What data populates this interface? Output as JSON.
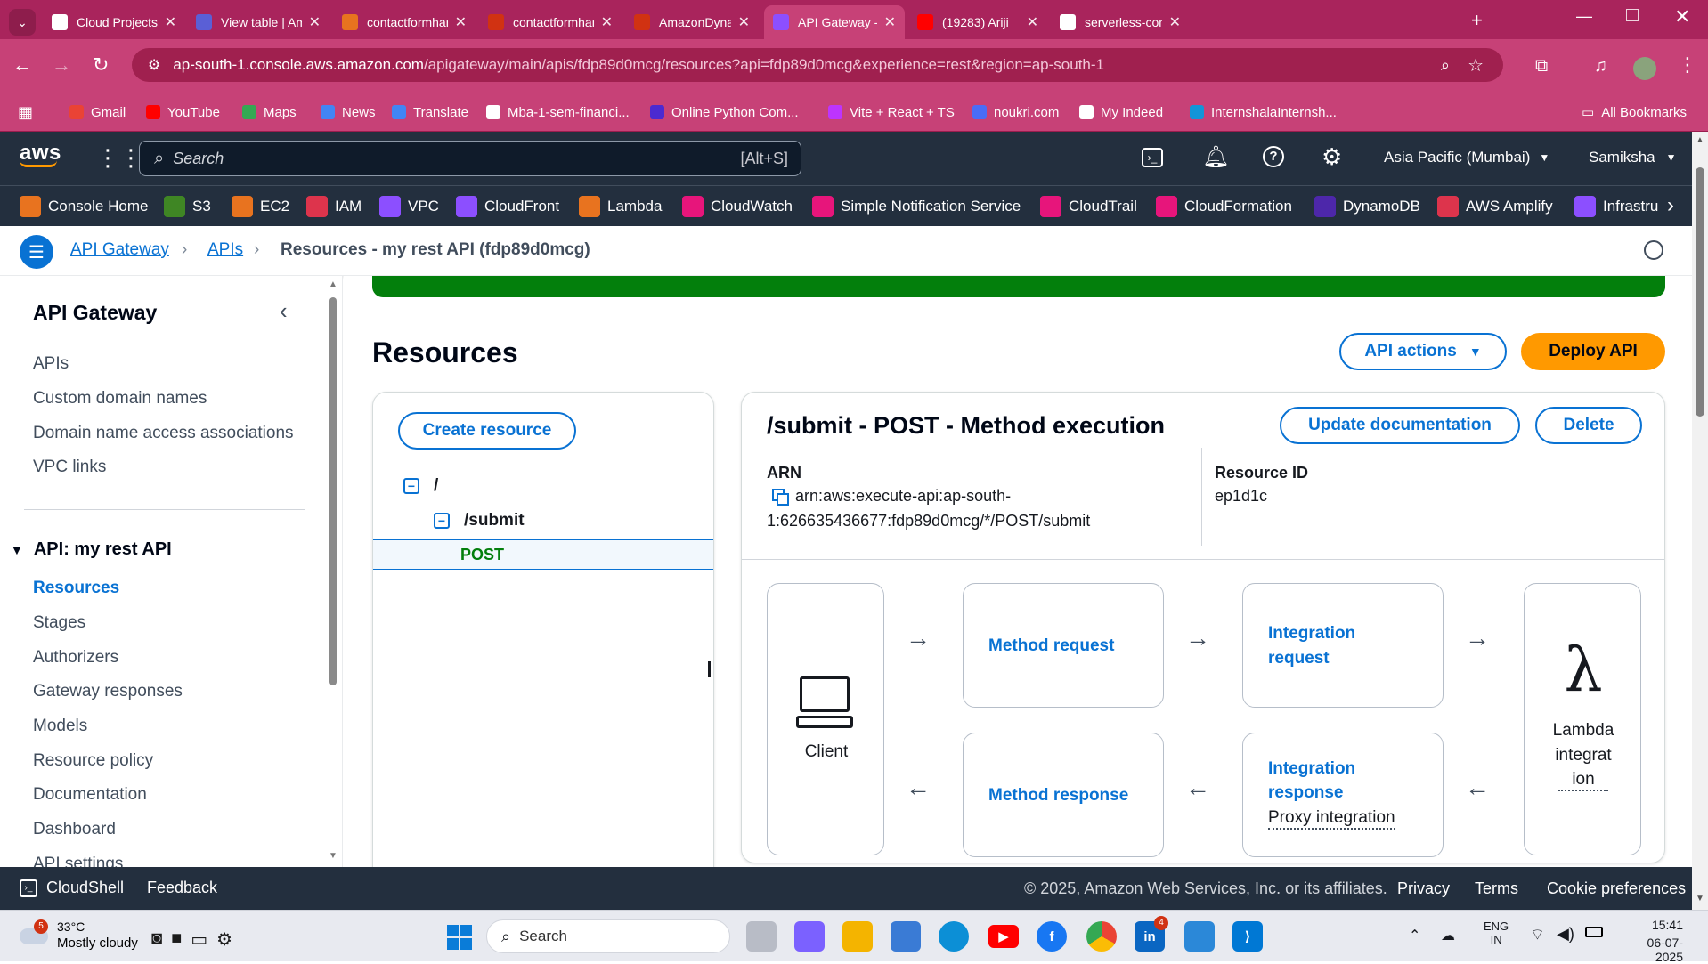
{
  "browser": {
    "tabs": [
      {
        "title": "Cloud Projects G",
        "color": "#ffffff",
        "icon": "chatgpt-icon"
      },
      {
        "title": "View table | Ama",
        "color": "#5a5fd6",
        "icon": "page-icon"
      },
      {
        "title": "contactformhanc",
        "color": "#e8731f",
        "icon": "lambda-icon"
      },
      {
        "title": "contactformhanc",
        "color": "#d13212",
        "icon": "page-icon"
      },
      {
        "title": "AmazonDynamo",
        "color": "#d13212",
        "icon": "page-icon"
      },
      {
        "title": "API Gateway - R",
        "color": "#8c4fff",
        "icon": "api-gateway-icon",
        "active": true
      },
      {
        "title": "(19283) Ariji",
        "color": "#ff0000",
        "icon": "youtube-icon"
      },
      {
        "title": "serverless-conta",
        "color": "#ffffff",
        "icon": "github-icon"
      }
    ],
    "url_host": "ap-south-1.console.aws.amazon.com",
    "url_path": "/apigateway/main/apis/fdp89d0mcg/resources?api=fdp89d0mcg&experience=rest&region=ap-south-1",
    "bookmarks": [
      {
        "label": "Gmail",
        "color": "#ea4335"
      },
      {
        "label": "YouTube",
        "color": "#ff0000"
      },
      {
        "label": "Maps",
        "color": "#34a853"
      },
      {
        "label": "News",
        "color": "#4285f4"
      },
      {
        "label": "Translate",
        "color": "#4285f4"
      },
      {
        "label": "Mba-1-sem-financi...",
        "color": "#ffffff"
      },
      {
        "label": "Online Python Com...",
        "color": "#4b2ad1"
      },
      {
        "label": "Vite + React + TS",
        "color": "#bd34fe"
      },
      {
        "label": "noukri.com",
        "color": "#4a6cf7"
      },
      {
        "label": "My Indeed",
        "color": "#ffffff"
      },
      {
        "label": "InternshalaInternsh...",
        "color": "#1295d8"
      }
    ],
    "all_bookmarks": "All Bookmarks"
  },
  "aws": {
    "logo": "aws",
    "search_placeholder": "Search",
    "search_shortcut": "[Alt+S]",
    "region": "Asia Pacific (Mumbai)",
    "user": "Samiksha",
    "services": [
      {
        "label": "Console Home",
        "color": "#e8731f"
      },
      {
        "label": "S3",
        "color": "#3f8624"
      },
      {
        "label": "EC2",
        "color": "#e8731f"
      },
      {
        "label": "IAM",
        "color": "#dd344c"
      },
      {
        "label": "VPC",
        "color": "#8c4fff"
      },
      {
        "label": "CloudFront",
        "color": "#8c4fff"
      },
      {
        "label": "Lambda",
        "color": "#e8731f"
      },
      {
        "label": "CloudWatch",
        "color": "#e7157b"
      },
      {
        "label": "Simple Notification Service",
        "color": "#e7157b"
      },
      {
        "label": "CloudTrail",
        "color": "#e7157b"
      },
      {
        "label": "CloudFormation",
        "color": "#e7157b"
      },
      {
        "label": "DynamoDB",
        "color": "#4d27aa"
      },
      {
        "label": "AWS Amplify",
        "color": "#dd344c"
      },
      {
        "label": "Infrastru",
        "color": "#8c4fff"
      }
    ]
  },
  "breadcrumb": {
    "items": [
      "API Gateway",
      "APIs",
      "Resources - my rest API (fdp89d0mcg)"
    ]
  },
  "sidebar": {
    "title": "API Gateway",
    "top_items": [
      "APIs",
      "Custom domain names",
      "Domain name access associations",
      "VPC links"
    ],
    "api_section": "API: my rest API",
    "api_items": [
      "Resources",
      "Stages",
      "Authorizers",
      "Gateway responses",
      "Models",
      "Resource policy",
      "Documentation",
      "Dashboard",
      "API settings"
    ],
    "active_item": "Resources"
  },
  "main": {
    "page_title": "Resources",
    "api_actions": "API actions",
    "deploy_api": "Deploy API",
    "create_resource": "Create resource",
    "tree": {
      "root": "/",
      "child": "/submit",
      "method": "POST"
    },
    "method_panel": {
      "title": "/submit - POST - Method execution",
      "update_doc": "Update documentation",
      "delete": "Delete",
      "arn_label": "ARN",
      "arn_line1": "arn:aws:execute-api:ap-south-",
      "arn_line2": "1:626635436677:fdp89d0mcg/*/POST/submit",
      "resource_id_label": "Resource ID",
      "resource_id": "ep1d1c"
    },
    "flow": {
      "client": "Client",
      "method_request": "Method request",
      "integration_request_1": "Integration",
      "integration_request_2": "request",
      "lambda_1": "Lambda",
      "lambda_2": "integrat",
      "lambda_3": "ion",
      "method_response": "Method response",
      "integration_response_1": "Integration",
      "integration_response_2": "response",
      "proxy": "Proxy integration"
    }
  },
  "footer": {
    "cloudshell": "CloudShell",
    "feedback": "Feedback",
    "copyright": "© 2025, Amazon Web Services, Inc. or its affiliates.",
    "privacy": "Privacy",
    "terms": "Terms",
    "cookies": "Cookie preferences"
  },
  "taskbar": {
    "weather_temp": "33°C",
    "weather_desc": "Mostly cloudy",
    "weather_badge": "5",
    "search": "Search",
    "lang1": "ENG",
    "lang2": "IN",
    "time": "15:41",
    "date": "06-07-2025",
    "linkedin_badge": "4"
  }
}
